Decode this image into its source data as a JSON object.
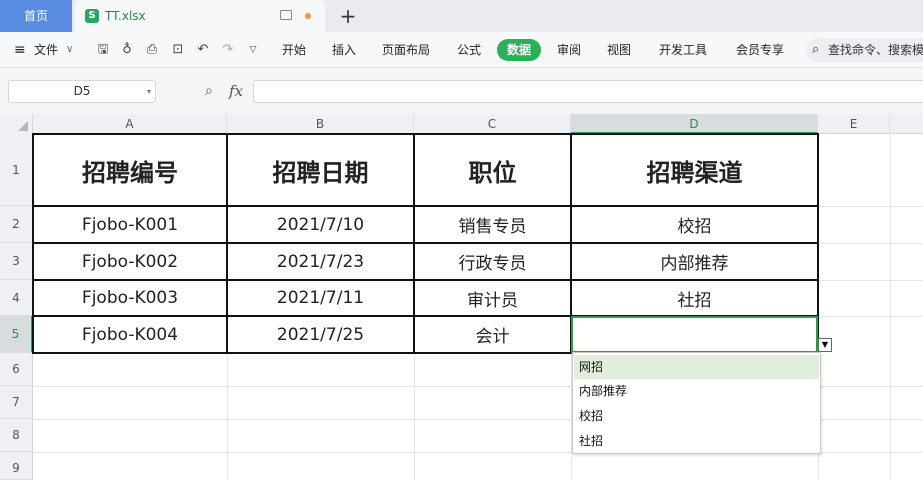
{
  "tabs": {
    "home": "首页",
    "file": "TT.xlsx",
    "file_icon": "S",
    "new_tab": "+"
  },
  "ribbon": {
    "menu_icon": "≡",
    "file_menu": "文件",
    "file_menu_arrow": "∨",
    "quick_icons": [
      "save-icon",
      "format-painter-icon",
      "print-icon",
      "print-preview-icon",
      "undo-icon",
      "redo-icon",
      "more-icon"
    ],
    "tabs": [
      "开始",
      "插入",
      "页面布局",
      "公式",
      "数据",
      "审阅",
      "视图",
      "开发工具",
      "会员专享"
    ],
    "active_tab": "数据",
    "search_placeholder": "查找命令、搜索模板",
    "accent_color": "#2bb05a"
  },
  "formula_bar": {
    "name_box": "D5",
    "fx_label": "fx",
    "content": ""
  },
  "sheet": {
    "columns": [
      "A",
      "B",
      "C",
      "D",
      "E"
    ],
    "rows": [
      "1",
      "2",
      "3",
      "4",
      "5",
      "6",
      "7",
      "8",
      "9"
    ],
    "selected_column": "D",
    "selected_row": "5",
    "headers": [
      "招聘编号",
      "招聘日期",
      "职位",
      "招聘渠道"
    ],
    "data": [
      [
        "Fjobo-K001",
        "2021/7/10",
        "销售专员",
        "校招"
      ],
      [
        "Fjobo-K002",
        "2021/7/23",
        "行政专员",
        "内部推荐"
      ],
      [
        "Fjobo-K003",
        "2021/7/11",
        "审计员",
        "社招"
      ],
      [
        "Fjobo-K004",
        "2021/7/25",
        "会计",
        ""
      ]
    ]
  },
  "dropdown": {
    "arrow": "▼",
    "options": [
      "网招",
      "内部推荐",
      "校招",
      "社招"
    ],
    "highlighted_index": 0
  }
}
